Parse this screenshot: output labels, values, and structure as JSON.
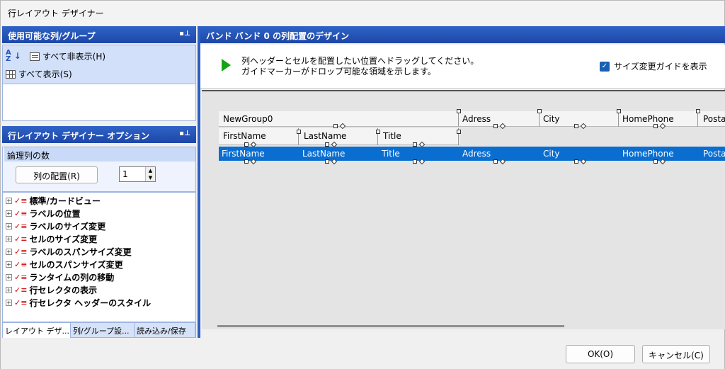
{
  "window": {
    "title": "行レイアウト デザイナー"
  },
  "left": {
    "columns_panel": {
      "title": "使用可能な列/グループ",
      "hide_all": "すべて非表示(H)",
      "show_all": "すべて表示(S)",
      "sort_icon": "A↓Z"
    },
    "options_panel": {
      "title": "行レイアウト デザイナー オプション",
      "logical_columns_label": "論理列の数",
      "arrange_button": "列の配置(R)",
      "column_count": "1",
      "tree_items": [
        "標準/カードビュー",
        "ラベルの位置",
        "ラベルのサイズ変更",
        "セルのサイズ変更",
        "ラベルのスパンサイズ変更",
        "セルのスパンサイズ変更",
        "ランタイムの列の移動",
        "行セレクタの表示",
        "行セレクタ ヘッダーのスタイル"
      ]
    },
    "tabs": [
      "レイアウト デザ...",
      "列/グループ設...",
      "読み込み/保存"
    ]
  },
  "right": {
    "title": "バンド バンド 0 の列配置のデザイン",
    "instruction_line1": "列ヘッダーとセルを配置したい位置へドラッグしてください。",
    "instruction_line2": "ガイドマーカーがドロップ可能な領域を示します。",
    "show_resize_guide": "サイズ変更ガイドを表示",
    "group_row": {
      "group": "NewGroup0",
      "cols": [
        "Adress",
        "City",
        "HomePhone",
        "Posta"
      ]
    },
    "header_row": [
      "FirstName",
      "LastName",
      "Title"
    ],
    "selected_row": [
      "FirstName",
      "LastName",
      "Title",
      "Adress",
      "City",
      "HomePhone",
      "Posta"
    ]
  },
  "footer": {
    "ok": "OK(O)",
    "cancel": "キャンセル(C)"
  }
}
